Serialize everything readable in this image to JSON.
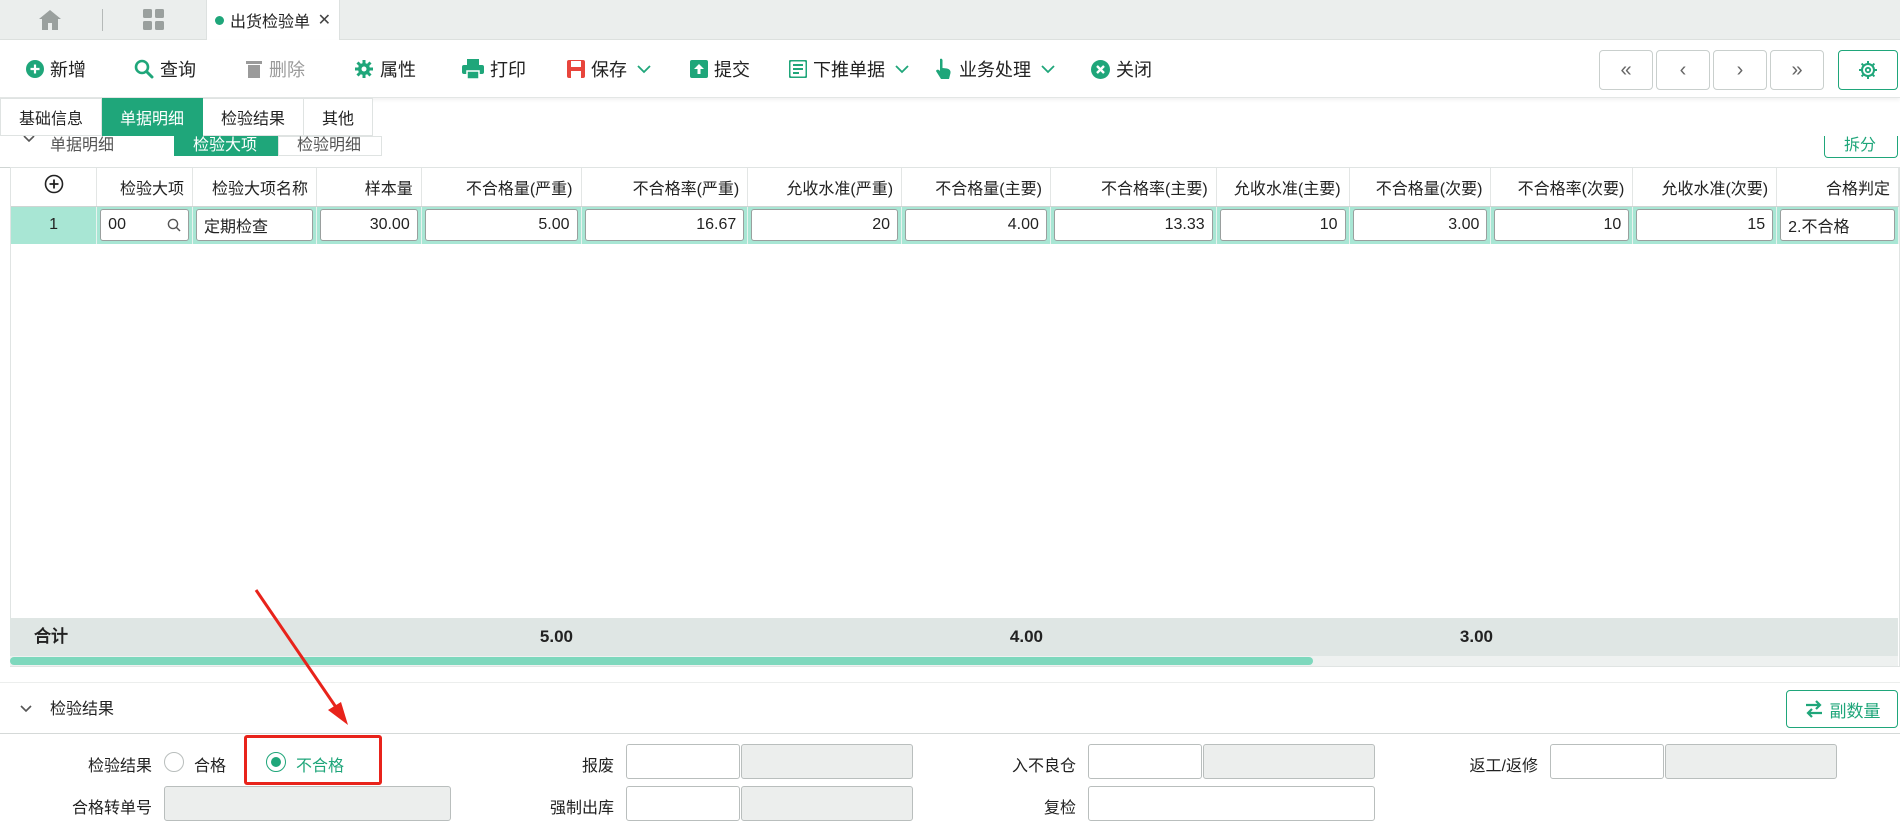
{
  "tabbar": {
    "home_icon": "home-icon",
    "apps_icon": "apps-grid-icon",
    "doc_tab_label": "出货检验单",
    "doc_tab_close": "✕"
  },
  "toolbar": {
    "new_label": "新增",
    "query_label": "查询",
    "delete_label": "删除",
    "properties_label": "属性",
    "print_label": "打印",
    "save_label": "保存",
    "submit_label": "提交",
    "push_label": "下推单据",
    "business_label": "业务处理",
    "close_label": "关闭",
    "first_glyph": "«",
    "prev_glyph": "‹",
    "next_glyph": "›",
    "last_glyph": "»"
  },
  "section_tabs": [
    "基础信息",
    "单据明细",
    "检验结果",
    "其他"
  ],
  "sub_header": {
    "section_title": "单据明细",
    "subtabs": [
      "检验大项",
      "检验明细"
    ],
    "split_button": "拆分"
  },
  "grid": {
    "columns": [
      "检验大项",
      "检验大项名称",
      "样本量",
      "不合格量(严重)",
      "不合格率(严重)",
      "允收水准(严重)",
      "不合格量(主要)",
      "不合格率(主要)",
      "允收水准(主要)",
      "不合格量(次要)",
      "不合格率(次要)",
      "允收水准(次要)",
      "合格判定"
    ],
    "rows": [
      {
        "num": "1",
        "cells": [
          "00",
          "定期检查",
          "30.00",
          "5.00",
          "16.67",
          "20",
          "4.00",
          "13.33",
          "10",
          "3.00",
          "10",
          "15",
          "2.不合格"
        ]
      }
    ],
    "total_label": "合计",
    "totals": {
      "severe": "5.00",
      "major": "4.00",
      "minor": "3.00"
    }
  },
  "result_section": {
    "title": "检验结果",
    "secondary_qty_button": "副数量",
    "labels": {
      "result": "检验结果",
      "pass": "合格",
      "fail": "不合格",
      "scrap": "报废",
      "defect_warehouse": "入不良仓",
      "rework": "返工/返修",
      "pass_transfer_no": "合格转单号",
      "forced_out": "强制出库",
      "recheck": "复检"
    },
    "selected": "不合格"
  },
  "colors": {
    "accent": "#1fa67a",
    "selected_row": "#a8e6d4",
    "annotation": "#e8231b"
  }
}
